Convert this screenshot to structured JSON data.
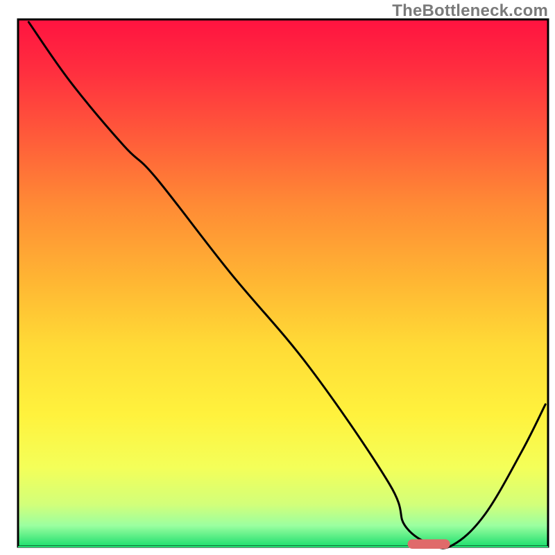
{
  "watermark": "TheBottleneck.com",
  "chart_data": {
    "type": "line",
    "title": "",
    "xlabel": "",
    "ylabel": "",
    "xlim": [
      0,
      100
    ],
    "ylim": [
      0,
      100
    ],
    "grid": false,
    "legend": "none",
    "background_gradient": {
      "stops": [
        {
          "offset": 0.0,
          "color": "#ff1340"
        },
        {
          "offset": 0.1,
          "color": "#ff2f3f"
        },
        {
          "offset": 0.22,
          "color": "#ff5a3a"
        },
        {
          "offset": 0.35,
          "color": "#ff8a35"
        },
        {
          "offset": 0.5,
          "color": "#ffb733"
        },
        {
          "offset": 0.62,
          "color": "#ffdb36"
        },
        {
          "offset": 0.75,
          "color": "#fff23d"
        },
        {
          "offset": 0.85,
          "color": "#f4ff59"
        },
        {
          "offset": 0.92,
          "color": "#d2ff7a"
        },
        {
          "offset": 0.96,
          "color": "#9bffa0"
        },
        {
          "offset": 1.0,
          "color": "#1dde6e"
        }
      ]
    },
    "series": [
      {
        "name": "bottleneck-curve",
        "color": "#000000",
        "x": [
          2,
          10,
          20,
          26,
          40,
          55,
          70,
          73,
          78,
          82,
          88,
          95,
          99.5
        ],
        "y": [
          99.5,
          88,
          76,
          70,
          52,
          34,
          12,
          4,
          0.4,
          0.3,
          6,
          18,
          27
        ]
      }
    ],
    "marker": {
      "name": "optimal-pill",
      "color": "#e06a6a",
      "cx": 77.5,
      "cy": 0.5,
      "rx": 4.0,
      "ry": 0.9
    },
    "baseline": {
      "color": "#1dde6e",
      "y": 0
    }
  }
}
